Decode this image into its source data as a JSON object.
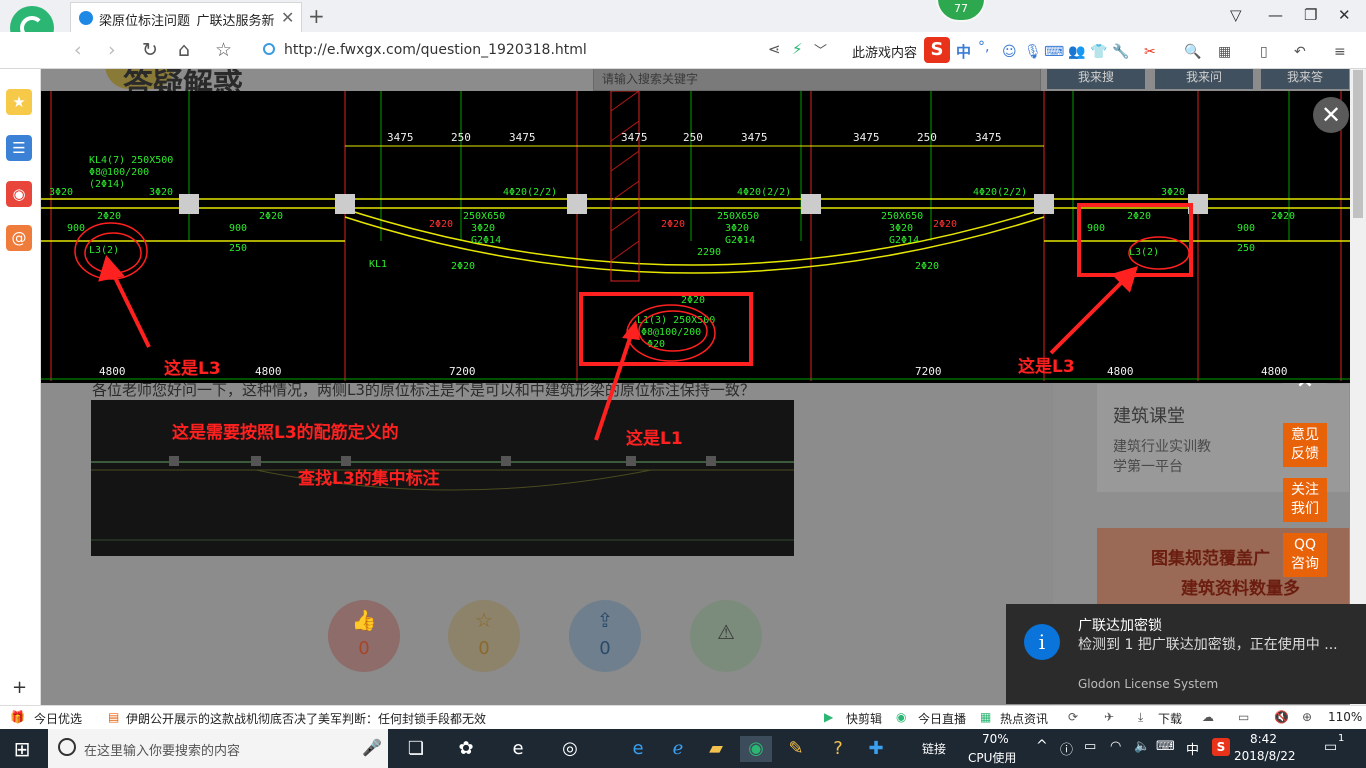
{
  "browser": {
    "tab_title": "梁原位标注问题_广联达服务新干线",
    "new_tab": "+",
    "notification_count": "77",
    "url": "http://e.fwxgx.com/question_1920318.html",
    "game_hint": "此游戏内容",
    "ime": {
      "logo": "S",
      "mode": "中",
      "punct": "°,"
    }
  },
  "page": {
    "search_placeholder": "请输入搜索关键字",
    "search_buttons": [
      "我来搜",
      "我来问",
      "我来答"
    ],
    "heading_partial": "答疑解惑",
    "question_tail": "各位老师您好问一下，这种情况，两侧L3的原位标注是不是可以和中建筑形梁的原位标注保持一致？",
    "drawing": {
      "dims_top": [
        "3475",
        "250",
        "3475",
        "3475",
        "250",
        "3475",
        "3475",
        "250",
        "3475"
      ],
      "dims_bottom": [
        "4800",
        "4800",
        "7200",
        "7200",
        "4800",
        "4800"
      ],
      "beam_labels": [
        "KL4(7) 250X500",
        "Φ8@100/200",
        "(2Φ14)",
        "3Φ20",
        "2Φ20",
        "4Φ20(2/2)",
        "250X650",
        "3Φ20",
        "G2Φ14",
        "L3(2)",
        "L1(3) 250X500",
        "Φ8@100/200",
        "Φ20",
        "KL1",
        "2290",
        "900",
        "250"
      ]
    },
    "annotations": {
      "l3_left": "这是L3",
      "l3_right": "这是L3",
      "l1": "这是L1",
      "note_line1": "这是需要按照L3的配筋定义的",
      "note_line2": "查找L3的集中标注"
    },
    "actions": [
      {
        "icon": "thumbs-up",
        "count": "0"
      },
      {
        "icon": "star",
        "count": "0"
      },
      {
        "icon": "share",
        "count": "0"
      },
      {
        "icon": "warning",
        "count": ""
      }
    ],
    "right_card": {
      "title": "建筑课堂",
      "line1": "建筑行业实训教",
      "line2": "学第一平台"
    },
    "right_ad": {
      "line1": "图集规范覆盖广",
      "line2": "建筑资料数量多"
    },
    "float_buttons": [
      "意见\n反馈",
      "关注\n我们",
      "QQ\n咨询"
    ]
  },
  "notification": {
    "title": "广联达加密锁",
    "body": "检测到 1 把广联达加密锁，正在使用中 ...",
    "source": "Glodon License System"
  },
  "statusbar": {
    "today": "今日优选",
    "news": "伊朗公开展示的这款战机彻底否决了美军判断：任何封锁手段都无效",
    "items": [
      "快剪辑",
      "今日直播",
      "热点资讯"
    ],
    "download": "下载",
    "zoom": "110%"
  },
  "taskbar": {
    "search_placeholder": "在这里输入你要搜索的内容",
    "link_label": "链接",
    "cpu_percent": "70%",
    "cpu_label": "CPU使用",
    "ime": "中",
    "time": "8:42",
    "date": "2018/8/22",
    "notifications": "1"
  },
  "colors": {
    "accent": "#e8620a",
    "annotation_red": "#ff2020",
    "drawing_green": "#2ee82e",
    "drawing_yellow": "#e6e600"
  }
}
